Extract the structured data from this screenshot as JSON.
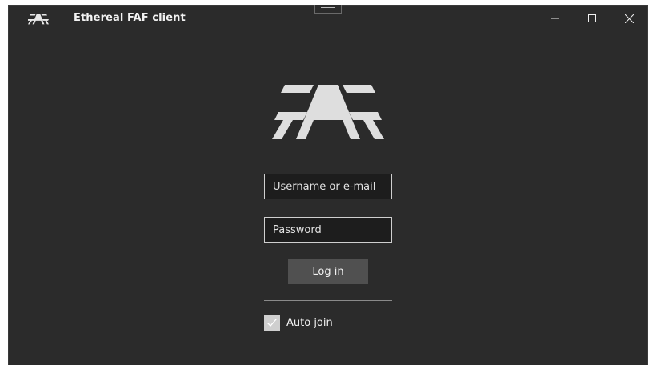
{
  "window": {
    "title": "Ethereal FAF client",
    "logo_icon": "faf-logo-icon",
    "controls": {
      "minimize_icon": "minimize-icon",
      "maximize_icon": "maximize-icon",
      "close_icon": "close-icon"
    }
  },
  "login": {
    "logo_icon": "faf-logo-icon",
    "username": {
      "value": "",
      "placeholder": "Username or e-mail"
    },
    "password": {
      "value": "",
      "placeholder": "Password"
    },
    "login_label": "Log in",
    "auto_join": {
      "label": "Auto join",
      "checked": true,
      "icon": "checkmark-icon"
    }
  },
  "colors": {
    "background": "#2b2b2b",
    "input_background": "#1d1d1d",
    "input_border": "#cfcfcf",
    "button_background": "#505050",
    "text": "#f2f2f2"
  }
}
